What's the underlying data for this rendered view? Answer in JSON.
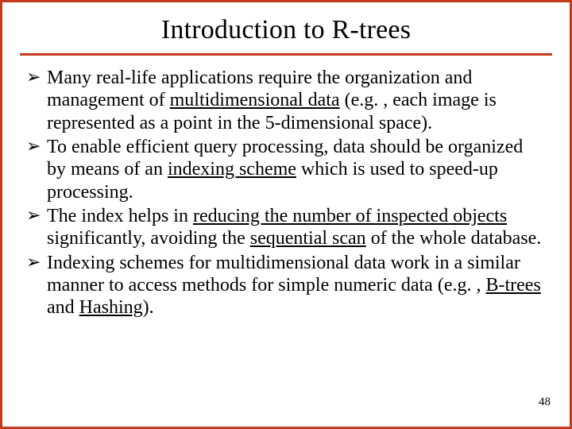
{
  "slide": {
    "title": "Introduction to R-trees",
    "bullet_glyph": "➢",
    "bullets": [
      {
        "t1": "Many real-life applications require the organization and management of ",
        "u1": "multidimensional data",
        "t2": " (e.g. , each image is represented as a point in the 5-dimensional space)."
      },
      {
        "t1": "To enable efficient query processing, data should be organized by means of an ",
        "u1": "indexing scheme",
        "t2": " which is used to speed-up processing."
      },
      {
        "t1": "The index helps in ",
        "u1": "reducing the number of inspected objects",
        "t2": " significantly, avoiding the ",
        "u2": "sequential scan",
        "t3": " of the whole database."
      },
      {
        "t1": "Indexing schemes for multidimensional data work in a similar manner to access methods for simple numeric data (e.g. , ",
        "u1": "B-trees",
        "t2": " and ",
        "u2": "Hashing",
        "t3": ")."
      }
    ],
    "page_number": "48"
  }
}
